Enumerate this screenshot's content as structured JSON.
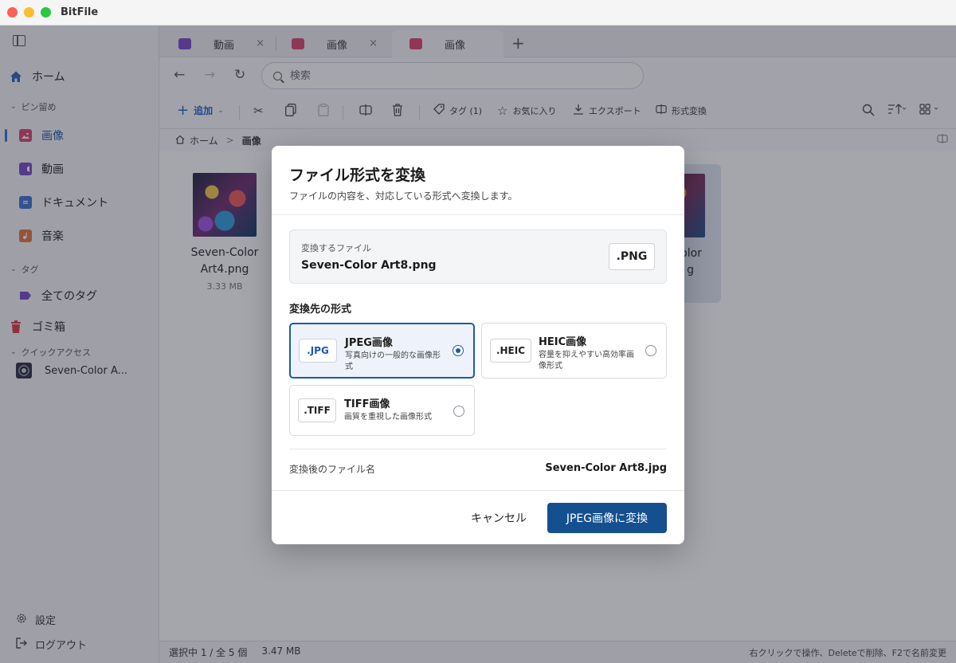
{
  "window": {
    "title": "BitFile"
  },
  "sidebar": {
    "home": "ホーム",
    "sections": {
      "pinned": "ピン留め",
      "tags": "タグ",
      "quick": "クイックアクセス"
    },
    "pinned": [
      {
        "label": "画像",
        "icon": "image-icon",
        "color": "#d9436b"
      },
      {
        "label": "動画",
        "icon": "video-icon",
        "color": "#7546c9"
      },
      {
        "label": "ドキュメント",
        "icon": "document-icon",
        "color": "#3a6fd0"
      },
      {
        "label": "音楽",
        "icon": "music-icon",
        "color": "#e0753a"
      }
    ],
    "all_tags": "全てのタグ",
    "trash": "ゴミ箱",
    "quick_item": "Seven-Color A...",
    "settings": "設定",
    "logout": "ログアウト"
  },
  "tabs": [
    {
      "label": "動画",
      "close": "×",
      "color": "#7546c9"
    },
    {
      "label": "画像",
      "close": "×",
      "color": "#d9436b"
    },
    {
      "label": "画像",
      "close": "×",
      "color": "#d9436b"
    }
  ],
  "tab_add": "+",
  "search": {
    "placeholder": "検索"
  },
  "toolbar": {
    "add": "追加",
    "tags": "タグ (1)",
    "favorite": "お気に入り",
    "export": "エクスポート",
    "convert": "形式変換"
  },
  "breadcrumb": {
    "home": "ホーム",
    "separator": ">",
    "current": "画像"
  },
  "files": [
    {
      "name1": "Seven-Color",
      "name2": "Art4.png",
      "size": "3.33 MB"
    },
    {
      "name1": "olor",
      "name2": "g",
      "size": ""
    }
  ],
  "status": {
    "selection": "選択中 1 / 全 5 個",
    "size": "3.47 MB",
    "hint": "右クリックで操作、Deleteで削除、F2で名前変更"
  },
  "dialog": {
    "title": "ファイル形式を変換",
    "subtitle": "ファイルの内容を、対応している形式へ変換します。",
    "source_label": "変換するファイル",
    "source_name": "Seven-Color Art8.png",
    "source_ext": ".PNG",
    "target_label": "変換先の形式",
    "options": [
      {
        "ext": ".JPG",
        "title": "JPEG画像",
        "desc": "写真向けの一般的な画像形式",
        "selected": true
      },
      {
        "ext": ".HEIC",
        "title": "HEIC画像",
        "desc": "容量を抑えやすい高効率画像形式",
        "selected": false
      },
      {
        "ext": ".TIFF",
        "title": "TIFF画像",
        "desc": "画質を重視した画像形式",
        "selected": false
      }
    ],
    "output_label": "変換後のファイル名",
    "output_name": "Seven-Color Art8.jpg",
    "cancel": "キャンセル",
    "confirm": "JPEG画像に変換"
  },
  "colors": {
    "accent": "#1d5aa8",
    "primary_button": "#14508f"
  }
}
